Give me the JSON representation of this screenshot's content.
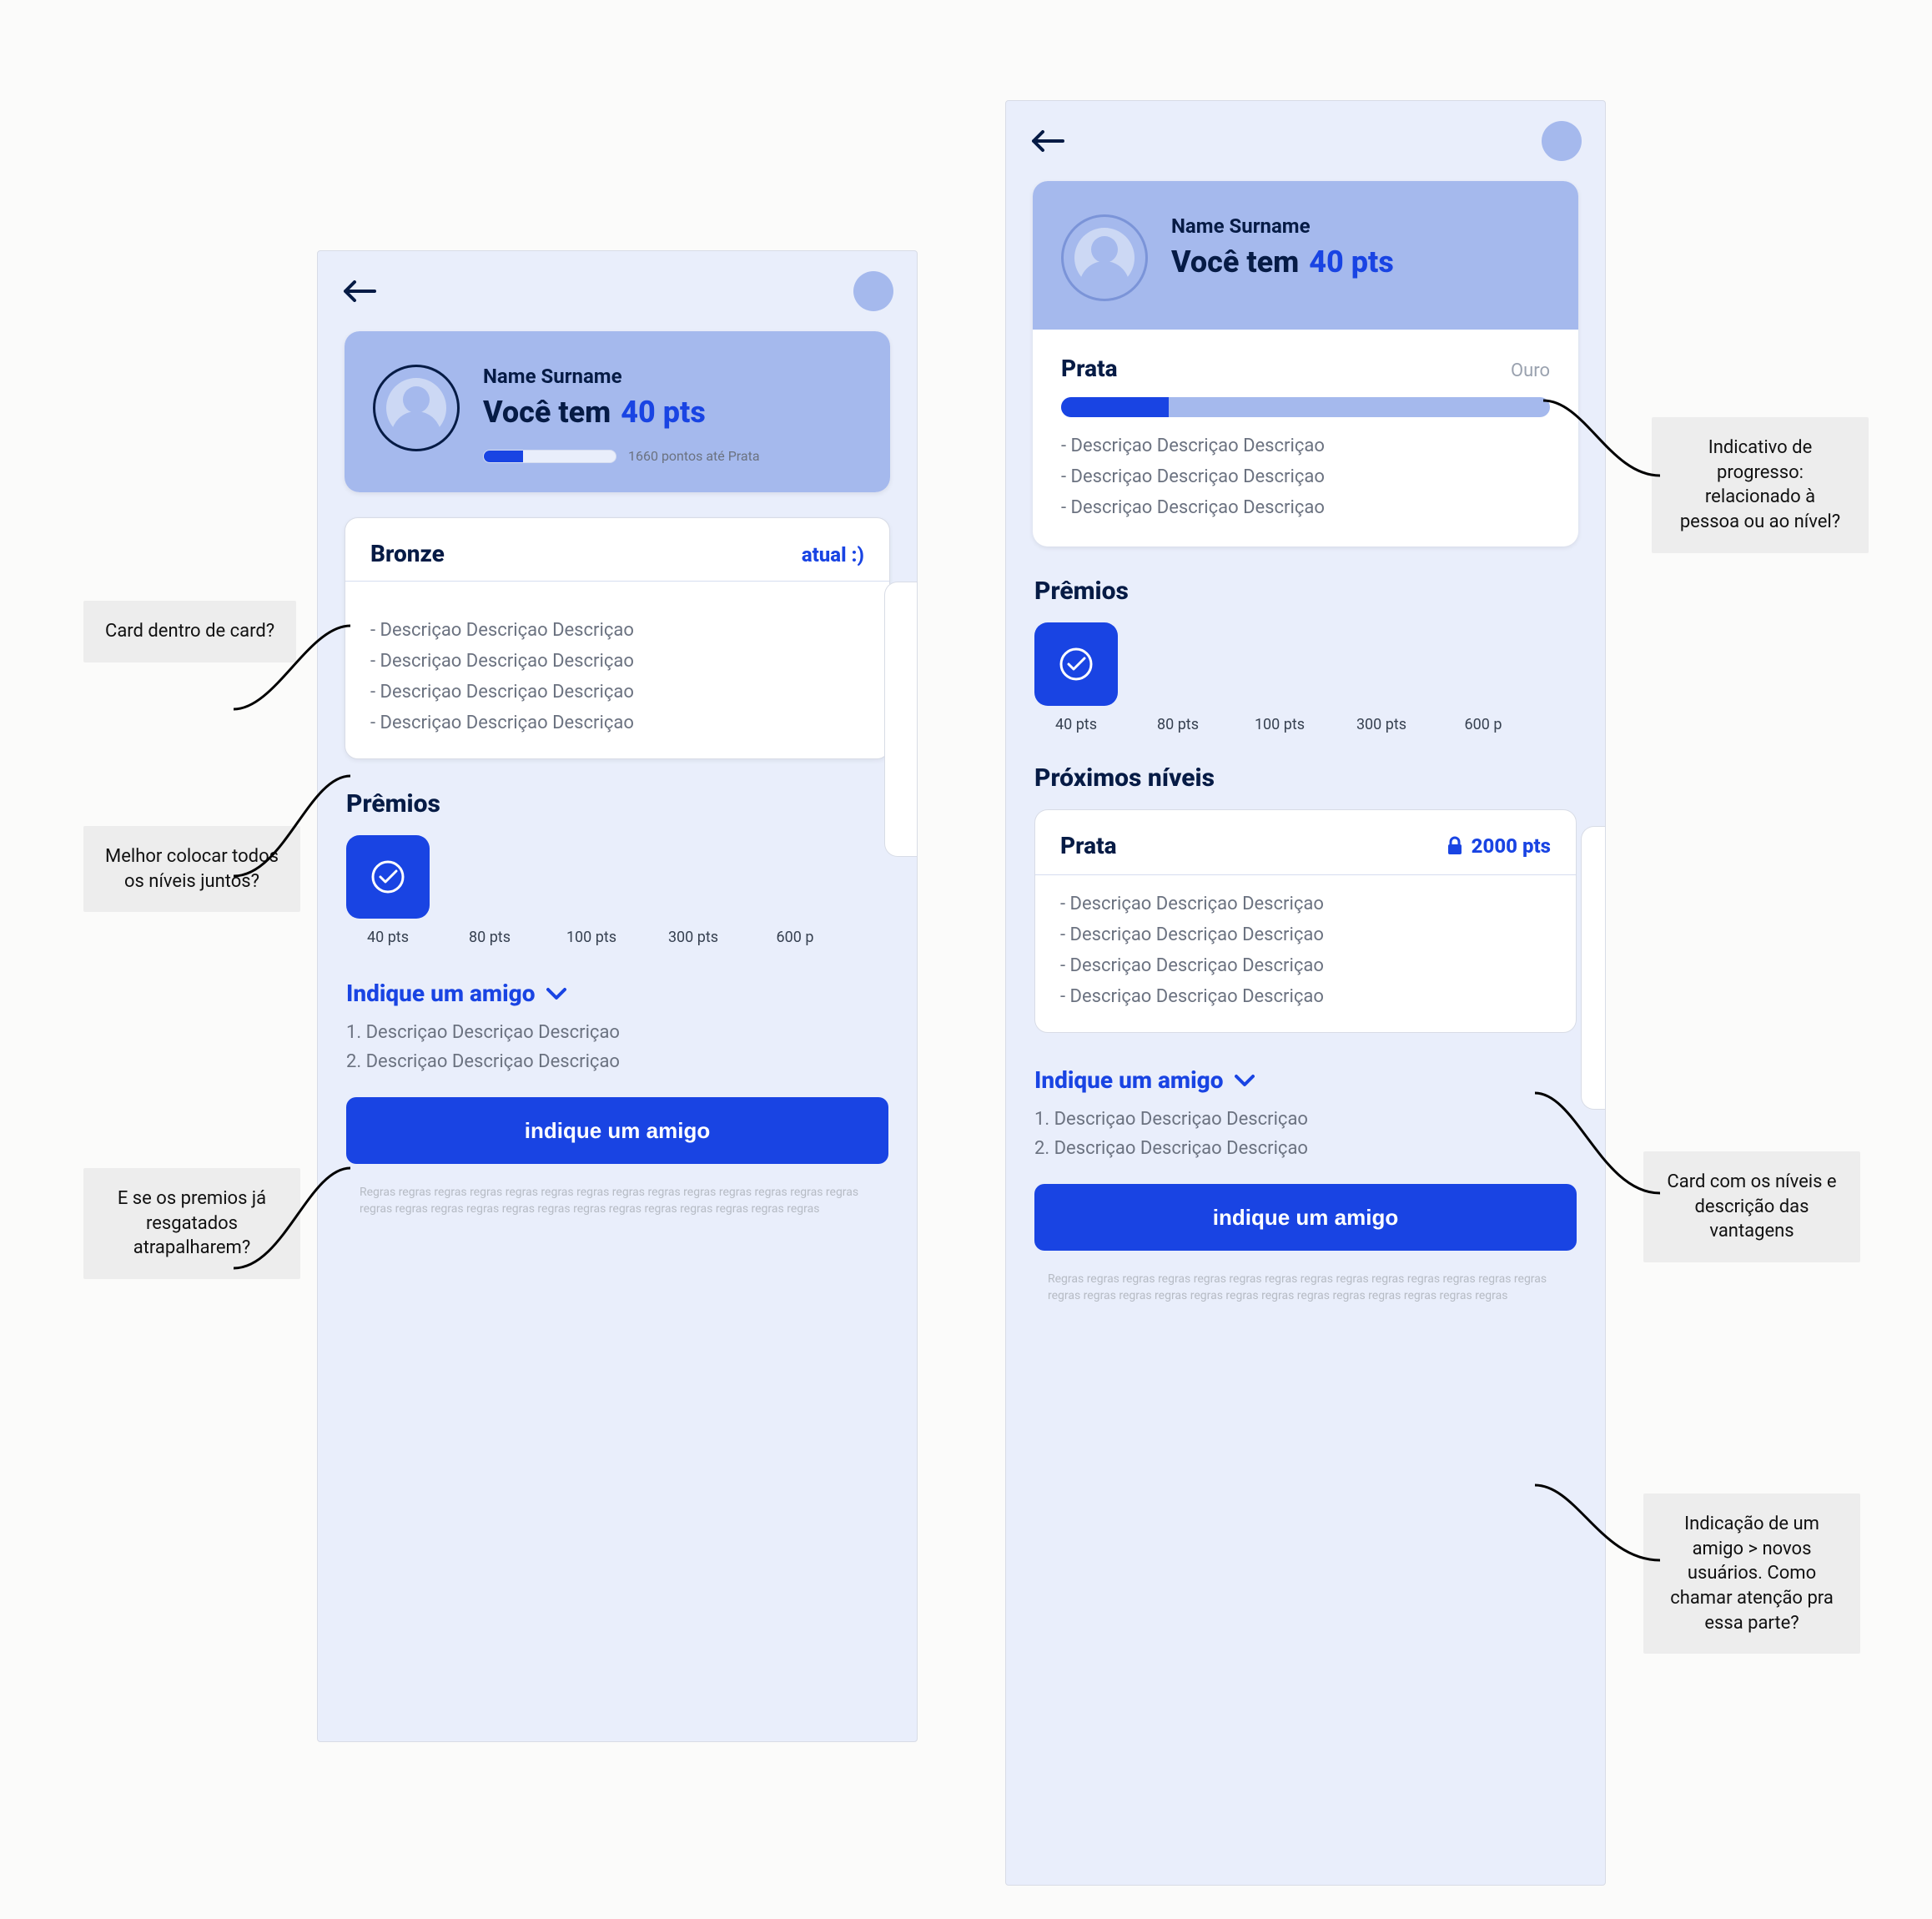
{
  "phoneA": {
    "hero": {
      "name": "Name Surname",
      "line_a": "Você tem",
      "line_b": "40 pts",
      "progress_hint": "1660 pontos até Prata"
    },
    "bronze": {
      "title": "Bronze",
      "badge": "atual :)",
      "items": [
        "- Descriçao Descriçao Descriçao",
        "- Descriçao Descriçao Descriçao",
        "- Descriçao Descriçao Descriçao",
        "- Descriçao Descriçao Descriçao"
      ]
    },
    "prizes_title": "Prêmios",
    "prizes": [
      "40 pts",
      "80 pts",
      "100 pts",
      "300 pts",
      "600 p"
    ],
    "invite_title": "Indique um amigo",
    "invite_steps": [
      "1. Descriçao Descriçao Descriçao",
      "2. Descriçao Descriçao Descriçao"
    ],
    "cta": "indique um amigo",
    "fineprint": "Regras regras regras regras regras regras regras regras regras regras regras regras regras regras regras regras regras regras regras regras regras regras regras regras regras regras regras"
  },
  "phoneB": {
    "hero": {
      "name": "Name Surname",
      "line_a": "Você tem",
      "line_b": "40 pts"
    },
    "level": {
      "current": "Prata",
      "next": "Ouro"
    },
    "level_desc": [
      "- Descriçao Descriçao Descriçao",
      "- Descriçao Descriçao Descriçao",
      "- Descriçao Descriçao Descriçao"
    ],
    "prizes_title": "Prêmios",
    "prizes": [
      "40 pts",
      "80 pts",
      "100 pts",
      "300 pts",
      "600 p"
    ],
    "next_levels_title": "Próximos níveis",
    "next_level": {
      "title": "Prata",
      "lock_pts": "2000 pts",
      "items": [
        "- Descriçao Descriçao Descriçao",
        "- Descriçao Descriçao Descriçao",
        "- Descriçao Descriçao Descriçao",
        "- Descriçao Descriçao Descriçao"
      ]
    },
    "invite_title": "Indique um amigo",
    "invite_steps": [
      "1. Descriçao Descriçao Descriçao",
      "2. Descriçao Descriçao Descriçao"
    ],
    "cta": "indique um amigo",
    "fineprint": "Regras regras regras regras regras regras regras regras regras regras regras regras regras regras regras regras regras regras regras regras regras regras regras regras regras regras regras"
  },
  "notes": {
    "a1": "Card dentro de card?",
    "a2": "Melhor colocar todos os níveis juntos?",
    "a3": "E se os premios já resgatados atrapalharem?",
    "b1": "Indicativo de progresso: relacionado à pessoa ou ao nível?",
    "b2": "Card com os níveis e descrição das vantagens",
    "b3": "Indicação de um amigo > novos usuários. Como chamar atenção pra essa parte?"
  }
}
